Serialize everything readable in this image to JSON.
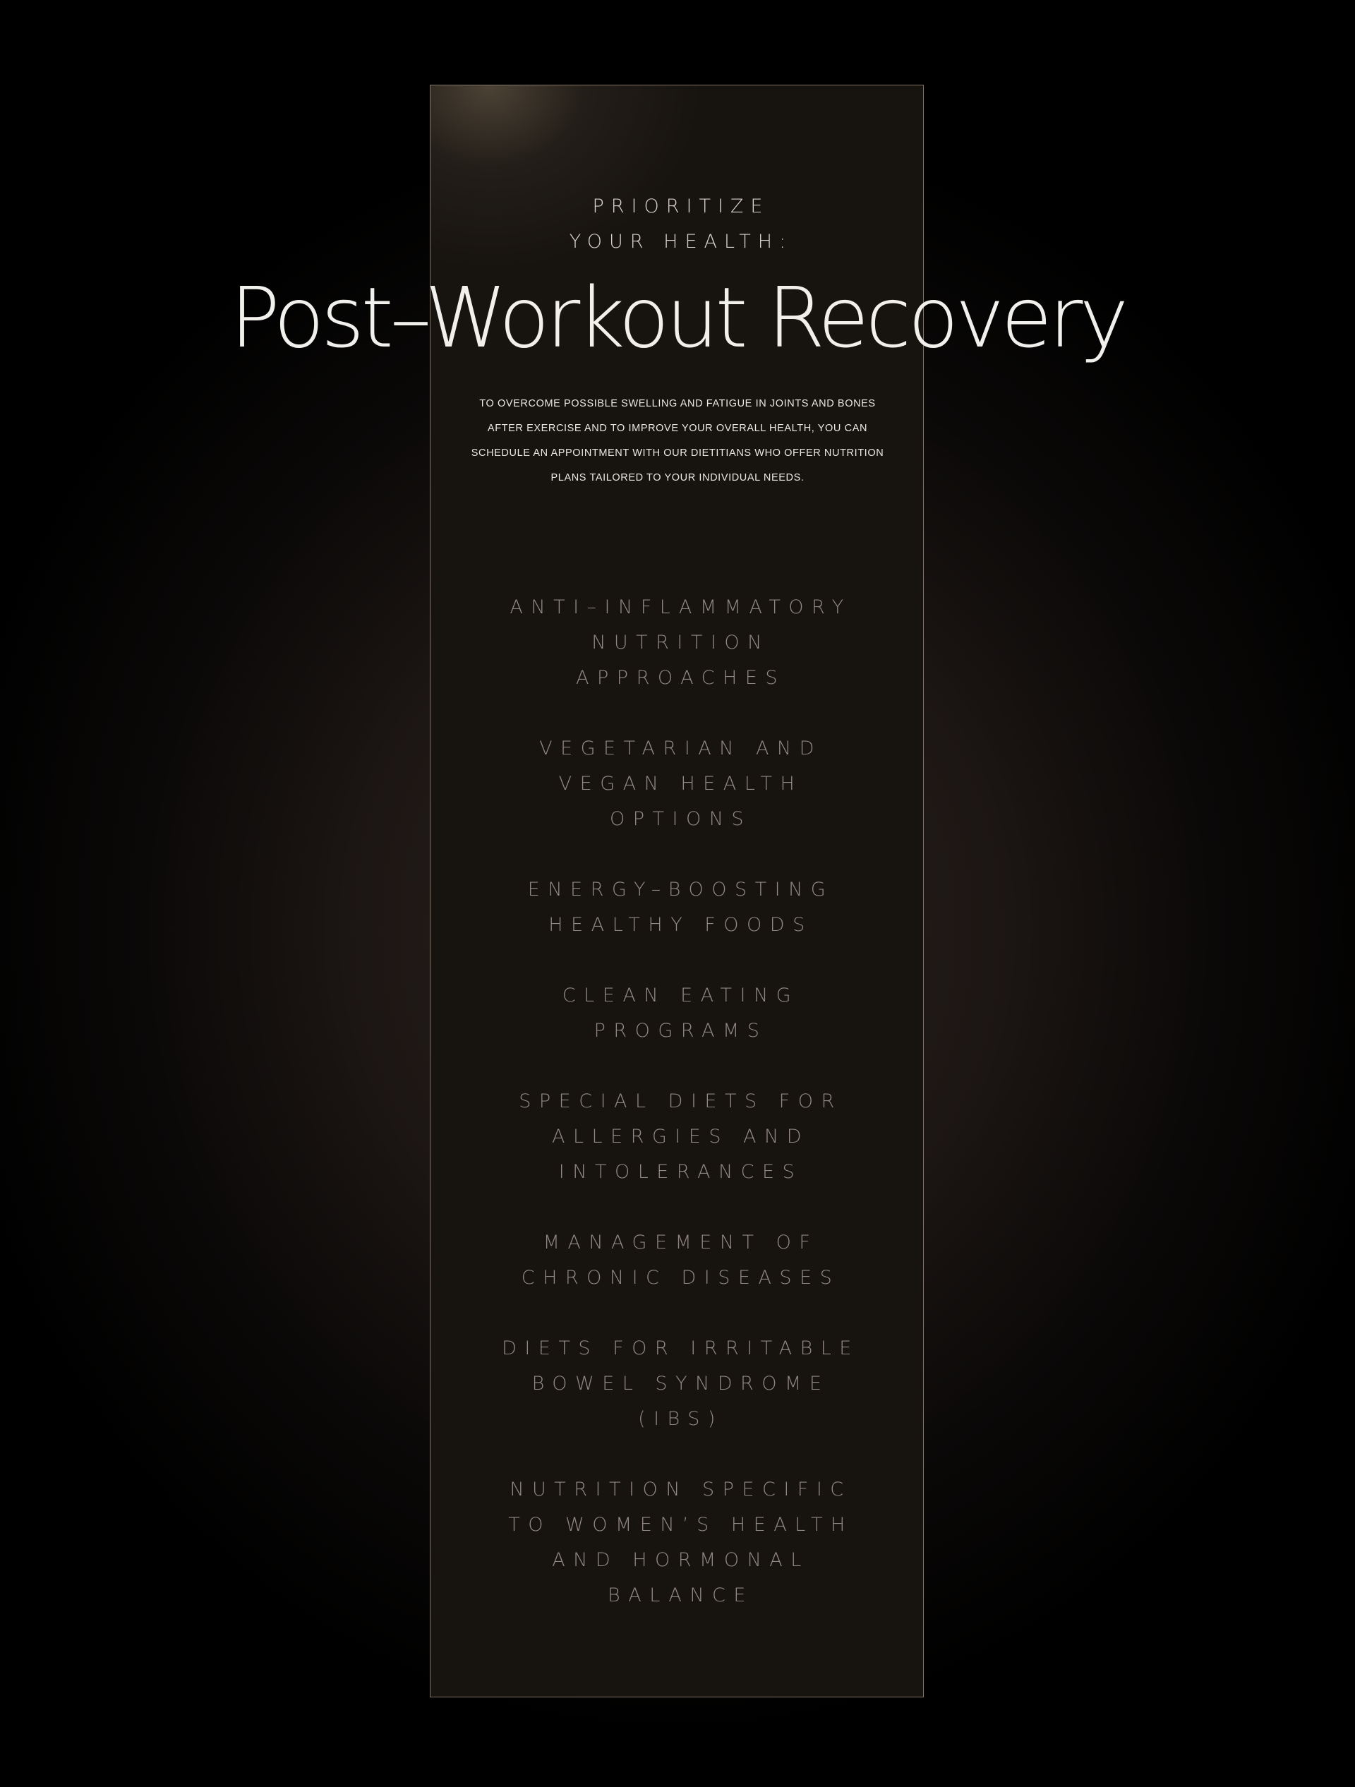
{
  "header": {
    "eyebrow_lines": [
      "PRIORITIZE",
      "YOUR HEALTH:"
    ],
    "title": "Post–Workout Recovery"
  },
  "intro": {
    "lines": [
      "TO OVERCOME POSSIBLE SWELLING AND FATIGUE IN JOINTS AND BONES",
      "AFTER EXERCISE AND TO IMPROVE YOUR OVERALL HEALTH, YOU CAN",
      "SCHEDULE AN APPOINTMENT WITH OUR DIETITIANS WHO OFFER NUTRITION",
      "PLANS TAILORED TO YOUR INDIVIDUAL NEEDS."
    ]
  },
  "services": [
    {
      "lines": [
        "ANTI–INFLAMMATORY",
        "NUTRITION",
        "APPROACHES"
      ]
    },
    {
      "lines": [
        "VEGETARIAN AND",
        "VEGAN HEALTH",
        "OPTIONS"
      ]
    },
    {
      "lines": [
        "ENERGY–BOOSTING",
        "HEALTHY FOODS"
      ]
    },
    {
      "lines": [
        "CLEAN EATING",
        "PROGRAMS"
      ]
    },
    {
      "lines": [
        "SPECIAL DIETS FOR",
        "ALLERGIES AND",
        "INTOLERANCES"
      ]
    },
    {
      "lines": [
        "MANAGEMENT OF",
        "CHRONIC DISEASES"
      ]
    },
    {
      "lines": [
        "DIETS FOR IRRITABLE",
        "BOWEL SYNDROME",
        "(IBS)"
      ]
    },
    {
      "lines": [
        "NUTRITION SPECIFIC",
        "TO WOMEN’S HEALTH",
        "AND HORMONAL",
        "BALANCE"
      ]
    }
  ],
  "colors": {
    "panel_border": "#7e7366",
    "panel_fill": "#17130f",
    "title_text": "#f2f0ed",
    "service_text": "#918880"
  }
}
